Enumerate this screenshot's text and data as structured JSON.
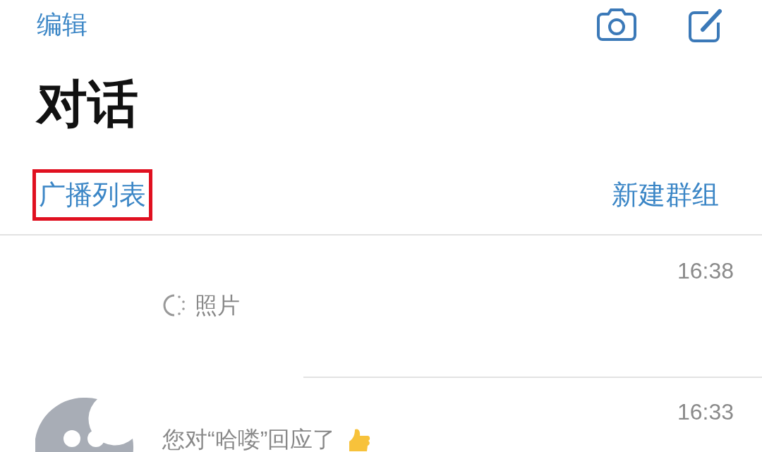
{
  "header": {
    "edit": "编辑"
  },
  "title": "对话",
  "links": [
    {
      "label": "广播列表",
      "highlighted": true
    },
    {
      "label": "新建群组",
      "highlighted": false
    }
  ],
  "chats": [
    {
      "kind": "photo",
      "time": "16:38",
      "preview": "照片",
      "avatar": false
    },
    {
      "kind": "reaction",
      "time": "16:33",
      "preview": "您对“哈喽”回应了",
      "avatar": true
    }
  ]
}
